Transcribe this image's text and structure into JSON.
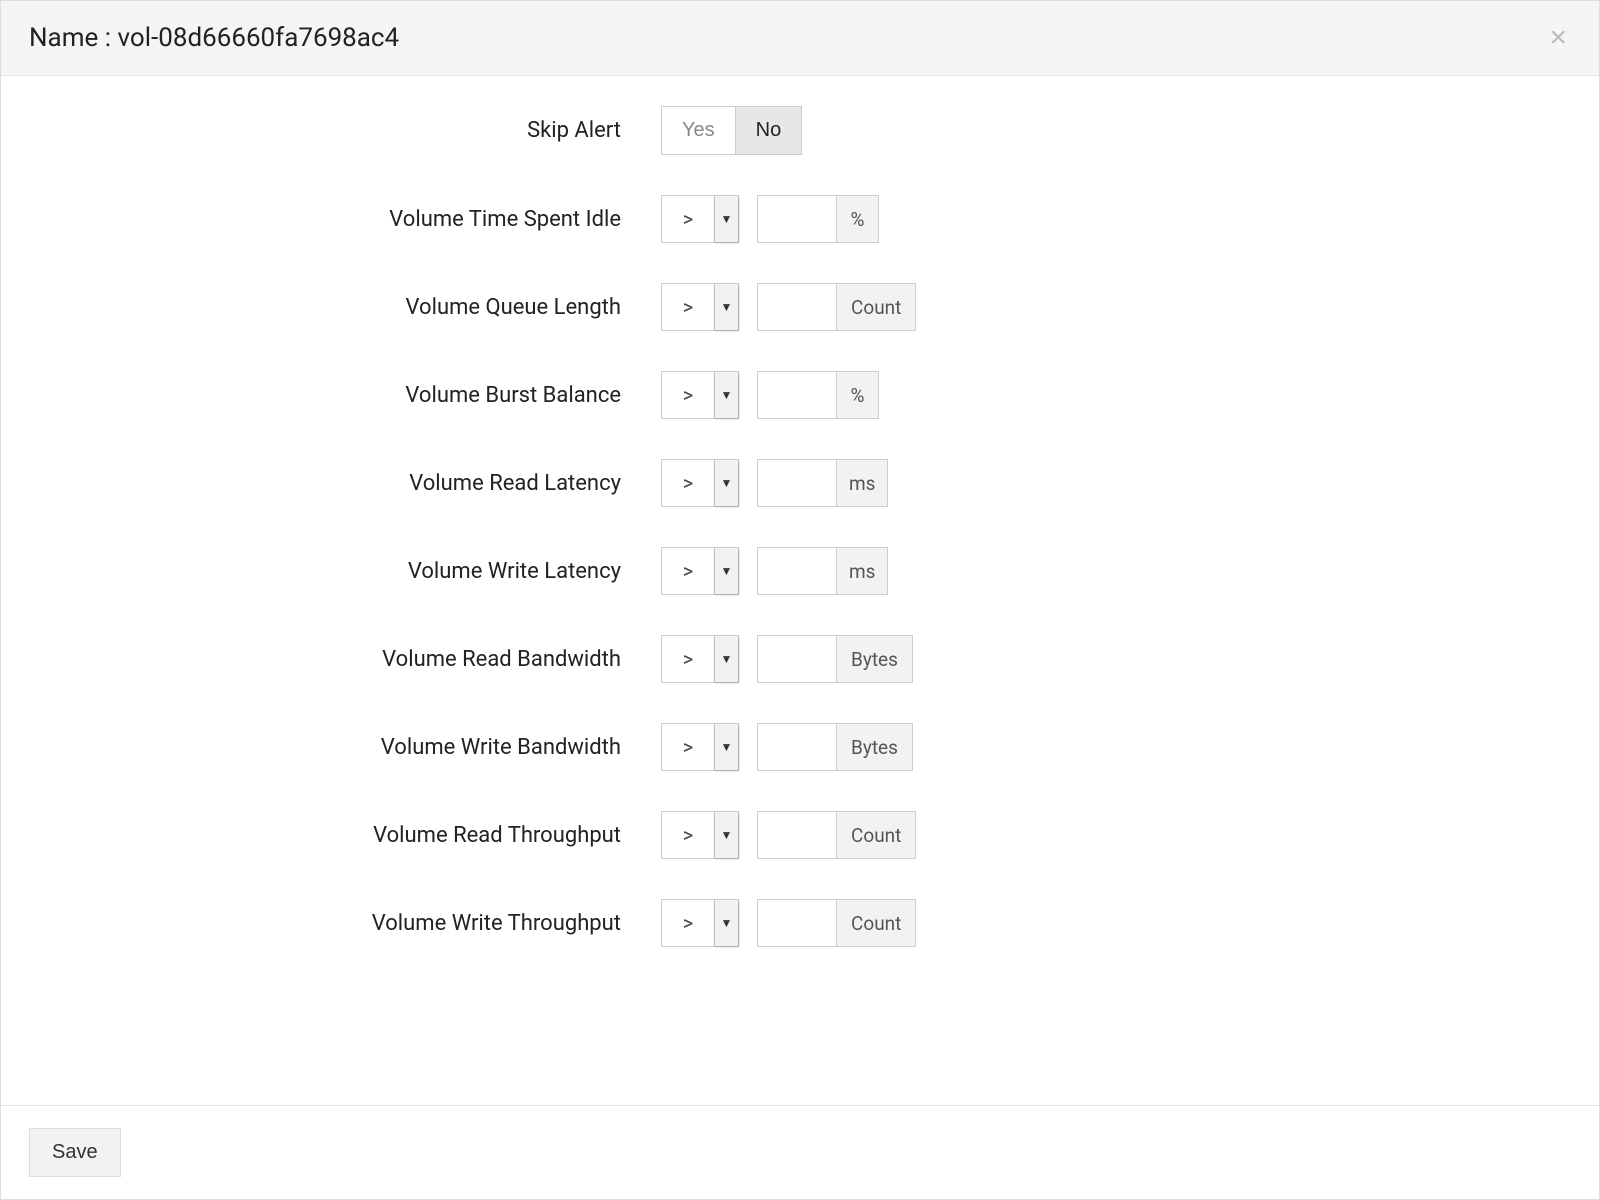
{
  "header": {
    "title": "Name : vol-08d66660fa7698ac4"
  },
  "skip_alert": {
    "label": "Skip Alert",
    "options": {
      "yes": "Yes",
      "no": "No"
    },
    "selected": "no"
  },
  "metrics": [
    {
      "key": "time-idle",
      "label": "Volume Time Spent Idle",
      "operator": ">",
      "value": "",
      "unit": "%",
      "unit_wide": false
    },
    {
      "key": "queue-length",
      "label": "Volume Queue Length",
      "operator": ">",
      "value": "",
      "unit": "Count",
      "unit_wide": true
    },
    {
      "key": "burst-balance",
      "label": "Volume Burst Balance",
      "operator": ">",
      "value": "",
      "unit": "%",
      "unit_wide": false
    },
    {
      "key": "read-latency",
      "label": "Volume Read Latency",
      "operator": ">",
      "value": "",
      "unit": "ms",
      "unit_wide": false
    },
    {
      "key": "write-latency",
      "label": "Volume Write Latency",
      "operator": ">",
      "value": "",
      "unit": "ms",
      "unit_wide": false
    },
    {
      "key": "read-bandwidth",
      "label": "Volume Read Bandwidth",
      "operator": ">",
      "value": "",
      "unit": "Bytes",
      "unit_wide": true
    },
    {
      "key": "write-bandwidth",
      "label": "Volume Write Bandwidth",
      "operator": ">",
      "value": "",
      "unit": "Bytes",
      "unit_wide": true
    },
    {
      "key": "read-throughput",
      "label": "Volume Read Throughput",
      "operator": ">",
      "value": "",
      "unit": "Count",
      "unit_wide": true
    },
    {
      "key": "write-throughput",
      "label": "Volume Write Throughput",
      "operator": ">",
      "value": "",
      "unit": "Count",
      "unit_wide": true
    }
  ],
  "footer": {
    "save_label": "Save"
  }
}
